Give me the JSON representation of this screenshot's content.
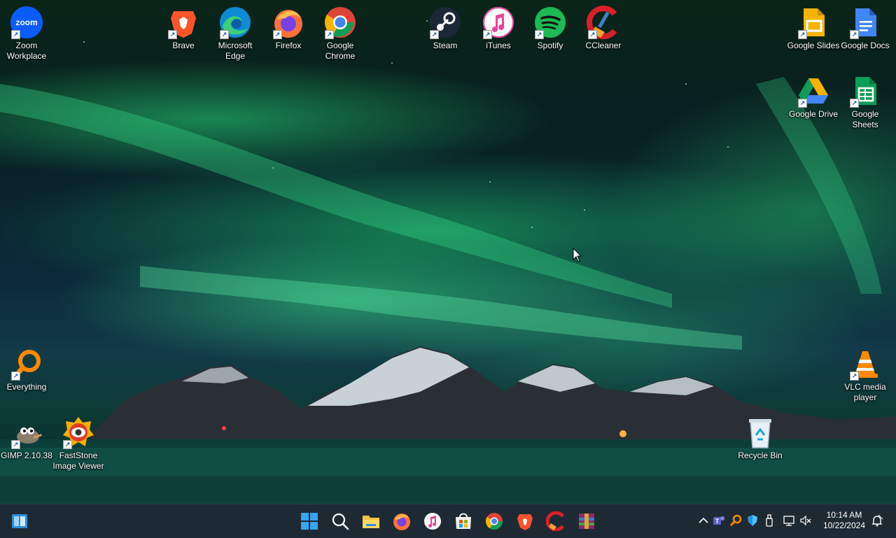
{
  "desktop": {
    "icons": {
      "zoom": {
        "label": "Zoom Workplace",
        "icon": "zoom-icon",
        "glyph_text": "zoom"
      },
      "brave": {
        "label": "Brave",
        "icon": "brave-icon"
      },
      "edge": {
        "label": "Microsoft Edge",
        "icon": "edge-icon"
      },
      "firefox": {
        "label": "Firefox",
        "icon": "firefox-icon"
      },
      "chrome": {
        "label": "Google Chrome",
        "icon": "chrome-icon"
      },
      "steam": {
        "label": "Steam",
        "icon": "steam-icon"
      },
      "itunes": {
        "label": "iTunes",
        "icon": "itunes-icon"
      },
      "spotify": {
        "label": "Spotify",
        "icon": "spotify-icon"
      },
      "ccleaner": {
        "label": "CCleaner",
        "icon": "ccleaner-icon"
      },
      "google_slides": {
        "label": "Google Slides",
        "icon": "google-slides-icon"
      },
      "google_docs": {
        "label": "Google Docs",
        "icon": "google-docs-icon"
      },
      "google_drive": {
        "label": "Google Drive",
        "icon": "google-drive-icon"
      },
      "google_sheets": {
        "label": "Google Sheets",
        "icon": "google-sheets-icon"
      },
      "everything": {
        "label": "Everything",
        "icon": "everything-search-icon"
      },
      "vlc": {
        "label": "VLC media player",
        "icon": "vlc-icon"
      },
      "gimp": {
        "label": "GIMP 2.10.38",
        "icon": "gimp-icon"
      },
      "faststone": {
        "label": "FastStone Image Viewer",
        "icon": "faststone-icon"
      },
      "recycle_bin": {
        "label": "Recycle Bin",
        "icon": "recycle-bin-icon"
      }
    }
  },
  "taskbar": {
    "start": {
      "icon": "windows-start-icon"
    },
    "apps": [
      {
        "icon": "windows-icon"
      },
      {
        "icon": "search-icon"
      },
      {
        "icon": "file-explorer-icon"
      },
      {
        "icon": "firefox-icon"
      },
      {
        "icon": "itunes-icon"
      },
      {
        "icon": "microsoft-store-icon"
      },
      {
        "icon": "chrome-icon"
      },
      {
        "icon": "brave-icon"
      },
      {
        "icon": "ccleaner-icon"
      },
      {
        "icon": "winrar-icon"
      }
    ],
    "tray": [
      {
        "icon": "chevron-up-icon"
      },
      {
        "icon": "teams-icon"
      },
      {
        "icon": "everything-search-icon"
      },
      {
        "icon": "defender-icon"
      },
      {
        "icon": "usb-drive-icon"
      },
      {
        "icon": "network-icon"
      },
      {
        "icon": "volume-muted-icon"
      }
    ],
    "clock": {
      "time": "10:14 AM",
      "date": "10/22/2024"
    },
    "notifications": {
      "icon": "notification-bell-icon"
    }
  },
  "colors": {
    "taskbar_bg": "#1e2a33",
    "aurora_green": "#2bd07a",
    "zoom_blue": "#0b5cff",
    "chrome_red": "#db4437",
    "spotify_green": "#1db954"
  }
}
